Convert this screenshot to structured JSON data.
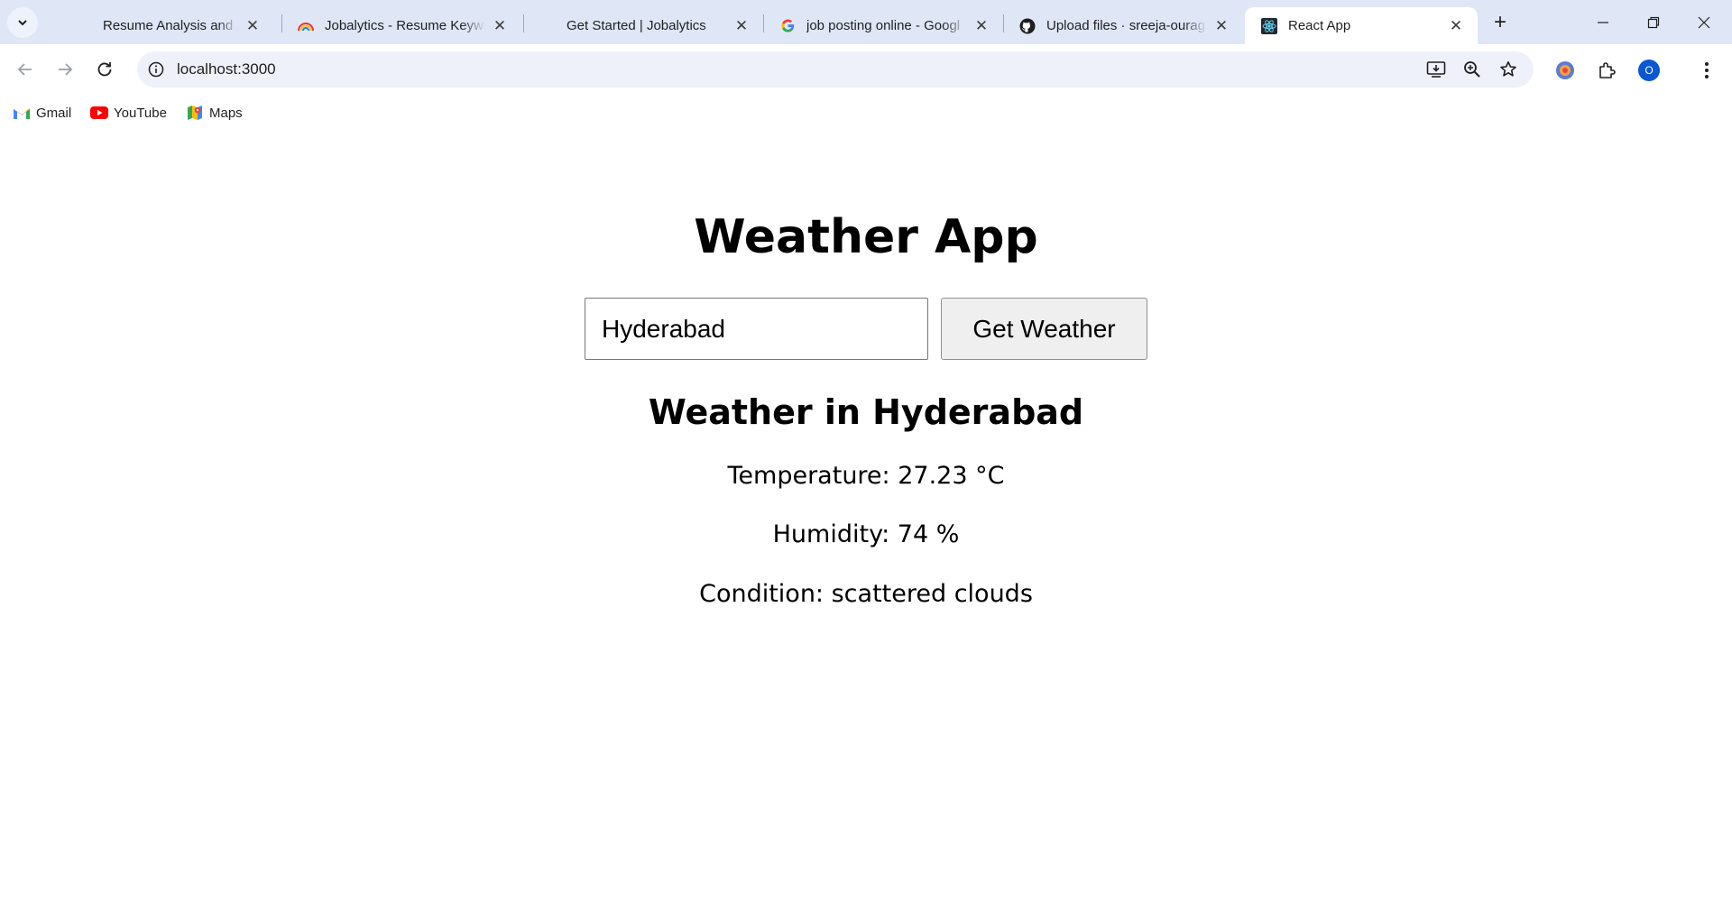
{
  "browser": {
    "tabs": [
      {
        "title": "Resume Analysis and Job S",
        "favicon": "none",
        "active": false
      },
      {
        "title": "Jobalytics - Resume Keywo",
        "favicon": "rainbow-icon",
        "active": false
      },
      {
        "title": "Get Started | Jobalytics",
        "favicon": "none",
        "active": false
      },
      {
        "title": "job posting online - Googl",
        "favicon": "google-icon",
        "active": false
      },
      {
        "title": "Upload files · sreeja-ourag",
        "favicon": "github-icon",
        "active": false
      },
      {
        "title": "React App",
        "favicon": "react-icon",
        "active": true
      }
    ],
    "close_glyph": "✕",
    "new_tab_glyph": "+",
    "address": "localhost:3000",
    "profile_initial": "O",
    "bookmarks": [
      {
        "label": "Gmail",
        "icon": "gmail-icon"
      },
      {
        "label": "YouTube",
        "icon": "youtube-icon"
      },
      {
        "label": "Maps",
        "icon": "maps-icon"
      }
    ]
  },
  "app": {
    "title": "Weather App",
    "city_input_value": "Hyderabad",
    "button_label": "Get Weather",
    "result_title": "Weather in Hyderabad",
    "temperature": "Temperature: 27.23 °C",
    "humidity": "Humidity: 74 %",
    "condition": "Condition: scattered clouds"
  },
  "colors": {
    "tabstrip_bg": "#dfe7f7",
    "omnibox_bg": "#eef1f9",
    "accent": "#0b57d0"
  }
}
